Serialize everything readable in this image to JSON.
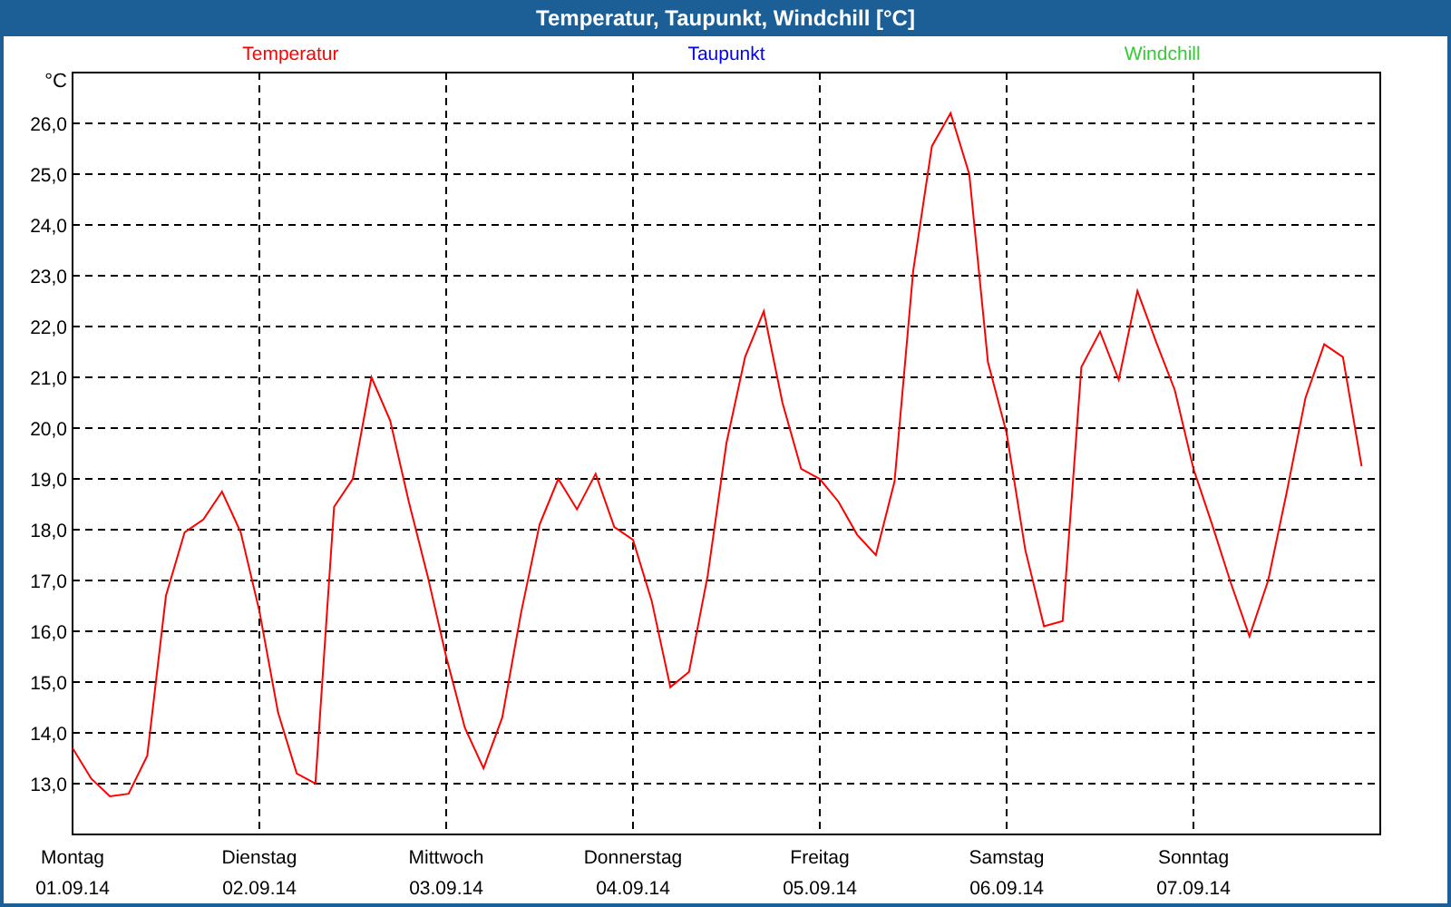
{
  "window": {
    "title": "Temperatur, Taupunkt, Windchill [°C]"
  },
  "legend": [
    {
      "name": "Taupunkt",
      "color": "#0000ff"
    },
    {
      "name": "Windchill",
      "color": "#33cc33"
    }
  ],
  "unit": "°C",
  "x_dates": [
    "01.09.14",
    "02.09.14",
    "03.09.14",
    "04.09.14",
    "05.09.14",
    "06.09.14",
    "07.09.14"
  ],
  "chart_data": {
    "type": "line",
    "grid": true,
    "ylim": [
      12,
      27
    ],
    "categories": [
      "Montag",
      null,
      null,
      null,
      null,
      null,
      null,
      null,
      null,
      null,
      "Dienstag",
      null,
      null,
      null,
      null,
      null,
      null,
      null,
      null,
      null,
      "Mittwoch",
      null,
      null,
      null,
      null,
      null,
      null,
      null,
      null,
      null,
      "Donnerstag",
      null,
      null,
      null,
      null,
      null,
      null,
      null,
      null,
      null,
      "Freitag",
      null,
      null,
      null,
      null,
      null,
      null,
      null,
      null,
      null,
      "Samstag",
      null,
      null,
      null,
      null,
      null,
      null,
      null,
      null,
      null,
      "Sonntag",
      null,
      null,
      null,
      null,
      null,
      null,
      null,
      null,
      null
    ],
    "yticks": [
      {
        "value": 13,
        "label": "13,0"
      },
      {
        "value": 14,
        "label": "14,0"
      },
      {
        "value": 15,
        "label": "15,0"
      },
      {
        "value": 16,
        "label": "16,0"
      },
      {
        "value": 17,
        "label": "17,0"
      },
      {
        "value": 18,
        "label": "18,0"
      },
      {
        "value": 19,
        "label": "19,0"
      },
      {
        "value": 20,
        "label": "20,0"
      },
      {
        "value": 21,
        "label": "21,0"
      },
      {
        "value": 22,
        "label": "22,0"
      },
      {
        "value": 23,
        "label": "23,0"
      },
      {
        "value": 24,
        "label": "24,0"
      },
      {
        "value": 25,
        "label": "25,0"
      },
      {
        "value": 26,
        "label": "26,0"
      }
    ],
    "series": [
      {
        "name": "Temperatur",
        "color": "#ff0000",
        "values": [
          13.7,
          13.1,
          12.75,
          12.8,
          13.55,
          16.7,
          17.95,
          18.2,
          18.75,
          17.95,
          16.4,
          14.4,
          13.2,
          13.0,
          18.45,
          19.0,
          21.0,
          20.15,
          18.55,
          17.1,
          15.5,
          14.1,
          13.3,
          14.3,
          16.35,
          18.1,
          19.0,
          18.4,
          19.1,
          18.05,
          17.8,
          16.6,
          14.9,
          15.2,
          17.1,
          19.7,
          21.4,
          22.3,
          20.5,
          19.2,
          19.0,
          18.55,
          17.9,
          17.5,
          18.95,
          23.1,
          25.55,
          26.2,
          25.0,
          21.3,
          19.9,
          17.6,
          16.1,
          16.2,
          21.2,
          21.9,
          20.95,
          22.7,
          21.7,
          20.75,
          19.2,
          18.1,
          16.95,
          15.9,
          17.0,
          18.75,
          20.6,
          21.65,
          21.4,
          19.25
        ]
      }
    ]
  }
}
